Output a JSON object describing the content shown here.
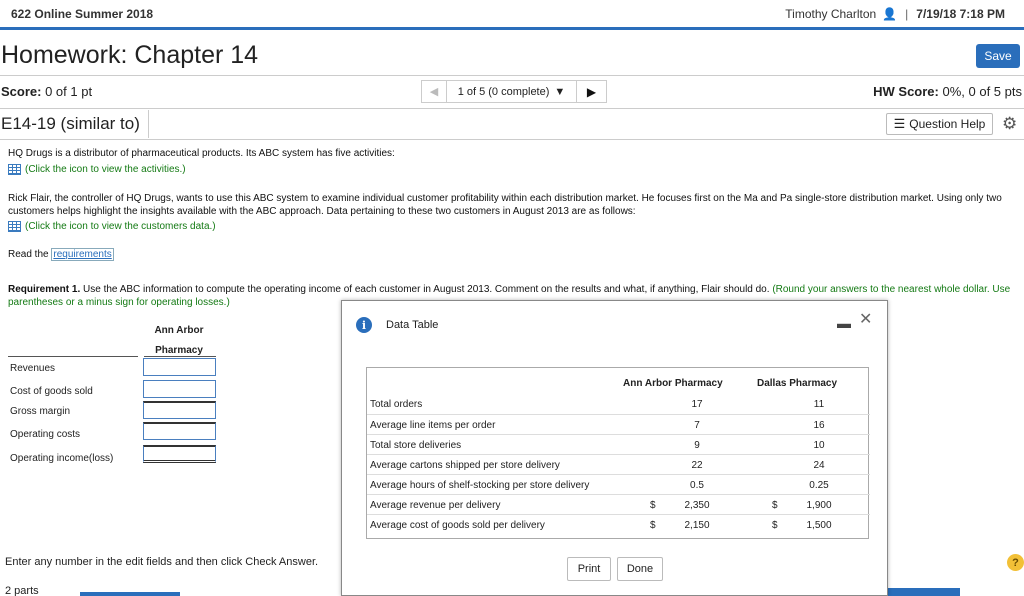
{
  "header": {
    "course": "622 Online Summer 2018",
    "user": "Timothy Charlton",
    "datetime": "7/19/18 7:18 PM"
  },
  "homework": {
    "title": "Homework: Chapter 14",
    "save_label": "Save",
    "score_label": "Score:",
    "score_value": "0 of 1 pt",
    "nav_position": "1 of 5 (0 complete)",
    "hw_score_label": "HW Score:",
    "hw_score_value": "0%, 0 of 5 pts",
    "question_id": "E14-19 (similar to)",
    "question_help_label": "Question Help"
  },
  "problem": {
    "p1": "HQ Drugs is a distributor of pharmaceutical products. Its ABC system has five activities:",
    "link_activities": "(Click the icon to view the activities.)",
    "p2": "Rick Flair, the controller of HQ Drugs, wants to use this ABC system to examine individual customer profitability within each distribution market. He focuses first on the Ma and Pa single-store distribution market. Using only two customers helps highlight the insights available with the ABC approach. Data pertaining to these two customers in August 2013 are as follows:",
    "link_customers": "(Click the icon to view the customers data.)",
    "read_the": "Read the",
    "requirements_link": "requirements",
    "requirement_label": "Requirement 1.",
    "requirement_text": "Use the ABC information to compute the operating income of each customer in August 2013. Comment on the results and what, if anything, Flair should do.",
    "requirement_note": "(Round your answers to the nearest whole dollar. Use parentheses or a minus sign for operating losses.)"
  },
  "answer_table": {
    "col_head_1": "Ann Arbor",
    "col_head_2": "Pharmacy",
    "rows": [
      "Revenues",
      "Cost of goods sold",
      "Gross margin",
      "Operating costs",
      "Operating income(loss)"
    ]
  },
  "footer": {
    "instruction": "Enter any number in the edit fields and then click Check Answer.",
    "parts": "2 parts",
    "help_glyph": "?"
  },
  "modal": {
    "title": "Data Table",
    "columns": [
      "Ann Arbor Pharmacy",
      "Dallas Pharmacy"
    ],
    "rows": [
      {
        "label": "Total orders",
        "ann": "17",
        "dallas": "11",
        "currency": ""
      },
      {
        "label": "Average line items per order",
        "ann": "7",
        "dallas": "16",
        "currency": ""
      },
      {
        "label": "Total store deliveries",
        "ann": "9",
        "dallas": "10",
        "currency": ""
      },
      {
        "label": "Average cartons shipped per store delivery",
        "ann": "22",
        "dallas": "24",
        "currency": ""
      },
      {
        "label": "Average hours of shelf-stocking per store delivery",
        "ann": "0.5",
        "dallas": "0.25",
        "currency": ""
      },
      {
        "label": "Average revenue per delivery",
        "ann": "2,350",
        "dallas": "1,900",
        "currency": "$"
      },
      {
        "label": "Average cost of goods sold per delivery",
        "ann": "2,150",
        "dallas": "1,500",
        "currency": "$"
      }
    ],
    "print_label": "Print",
    "done_label": "Done"
  },
  "colors": {
    "accent": "#2a6ebb",
    "green_note": "#147a14",
    "help_yellow": "#f2c037"
  }
}
